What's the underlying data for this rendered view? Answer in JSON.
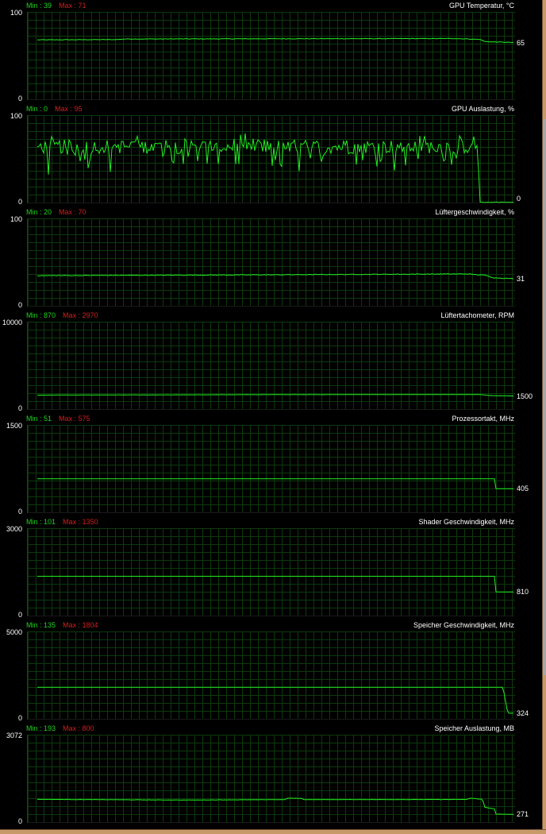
{
  "colors": {
    "background": "#000000",
    "grid": "#0d3a0d",
    "line": "#22ee22",
    "min": "#1ed41e",
    "max": "#d41e1e",
    "text": "#ffffff"
  },
  "graphs": [
    {
      "title": "GPU Temperatur, °C",
      "min_label": "Min : 39",
      "max_label": "Max : 71",
      "y_top": "100",
      "y_bottom": "0",
      "current": "65",
      "series": {
        "type": "flat",
        "values": [
          [
            0,
            68
          ],
          [
            0.17,
            68.4
          ],
          [
            0.18,
            69
          ],
          [
            0.5,
            69.3
          ],
          [
            0.88,
            69.5
          ],
          [
            0.93,
            68.5
          ],
          [
            0.94,
            66
          ],
          [
            1,
            65
          ]
        ],
        "noise": 0.3
      }
    },
    {
      "title": "GPU Auslastung, %",
      "min_label": "Min : 0",
      "max_label": "Max : 95",
      "y_top": "100",
      "y_bottom": "0",
      "current": "0",
      "series": {
        "type": "noisy",
        "base": 64,
        "amp": 16,
        "drop_at": 0.925,
        "end_value": 0
      }
    },
    {
      "title": "Lüftergeschwindigkeit, %",
      "min_label": "Min : 20",
      "max_label": "Max : 70",
      "y_top": "100",
      "y_bottom": "0",
      "current": "31",
      "series": {
        "type": "flat",
        "values": [
          [
            0,
            34.5
          ],
          [
            0.5,
            35.5
          ],
          [
            0.9,
            36.5
          ],
          [
            0.94,
            35
          ],
          [
            0.96,
            32
          ],
          [
            1,
            31
          ]
        ],
        "noise": 0.35
      }
    },
    {
      "title": "Lüftertachometer, RPM",
      "min_label": "Min : 870",
      "max_label": "Max : 2970",
      "y_top": "10000",
      "y_bottom": "0",
      "current": "1500",
      "series": {
        "type": "flat",
        "values": [
          [
            0,
            1600
          ],
          [
            0.5,
            1650
          ],
          [
            0.93,
            1660
          ],
          [
            0.95,
            1550
          ],
          [
            1,
            1500
          ]
        ],
        "noise": 8
      }
    },
    {
      "title": "Prozessortakt, MHz",
      "min_label": "Min : 51",
      "max_label": "Max : 575",
      "y_top": "1500",
      "y_bottom": "0",
      "current": "405",
      "series": {
        "type": "step",
        "high": 575,
        "low": 405,
        "drop_at": 0.962
      }
    },
    {
      "title": "Shader Geschwindigkeit, MHz",
      "min_label": "Min : 101",
      "max_label": "Max : 1350",
      "y_top": "3000",
      "y_bottom": "0",
      "current": "810",
      "series": {
        "type": "step",
        "high": 1350,
        "low": 810,
        "drop_at": 0.962
      }
    },
    {
      "title": "Speicher Geschwindigkeit, MHz",
      "min_label": "Min : 135",
      "max_label": "Max : 1804",
      "y_top": "5000",
      "y_bottom": "0",
      "current": "324",
      "series": {
        "type": "step",
        "high": 1804,
        "low": 324,
        "drop_at": 0.978,
        "ramp": 0.01
      }
    },
    {
      "title": "Speicher Auslastung, MB",
      "min_label": "Min : 193",
      "max_label": "Max : 800",
      "y_top": "3072",
      "y_bottom": "0",
      "current": "271",
      "series": {
        "type": "flat",
        "values": [
          [
            0,
            800
          ],
          [
            0.3,
            775
          ],
          [
            0.52,
            790
          ],
          [
            0.525,
            840
          ],
          [
            0.555,
            835
          ],
          [
            0.56,
            790
          ],
          [
            0.9,
            795
          ],
          [
            0.91,
            840
          ],
          [
            0.935,
            800
          ],
          [
            0.94,
            520
          ],
          [
            0.962,
            460
          ],
          [
            0.963,
            280
          ],
          [
            1,
            271
          ]
        ],
        "noise": 4
      }
    }
  ]
}
